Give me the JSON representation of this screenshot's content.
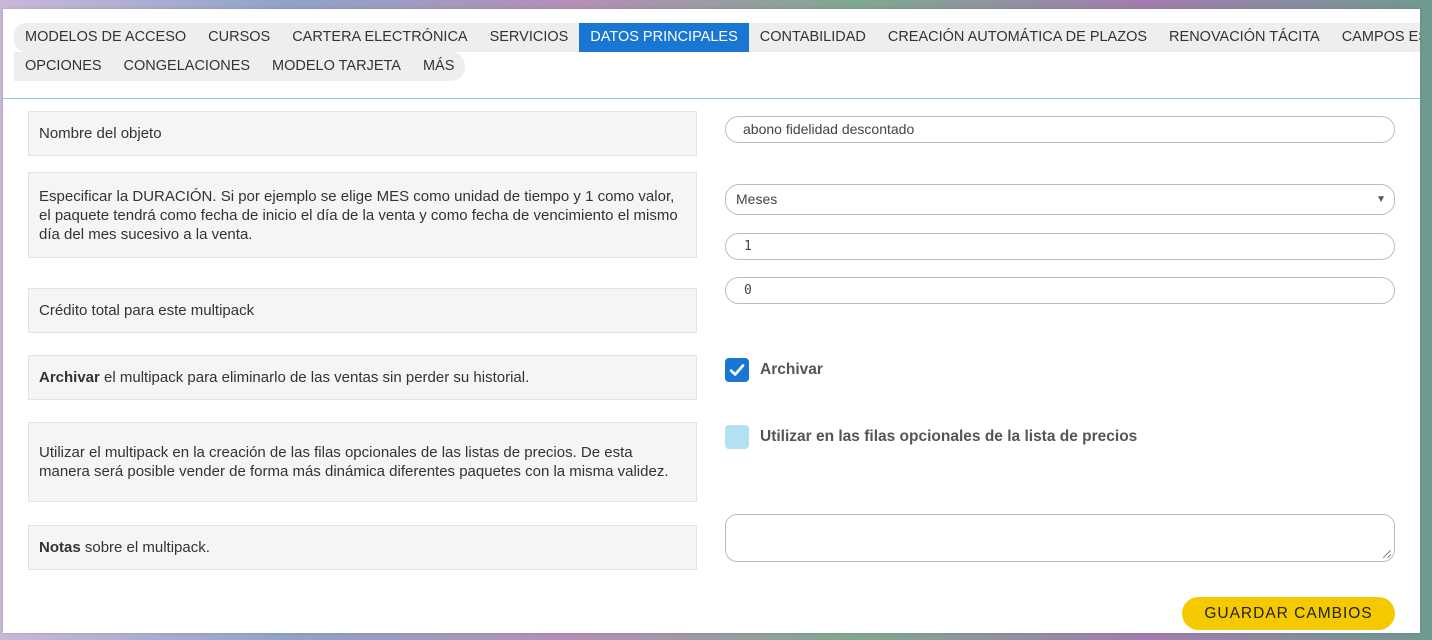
{
  "tabs": {
    "row1": [
      {
        "label": "MODELOS DE ACCESO"
      },
      {
        "label": "CURSOS"
      },
      {
        "label": "CARTERA ELECTRÓNICA"
      },
      {
        "label": "SERVICIOS"
      },
      {
        "label": "DATOS PRINCIPALES",
        "active": true
      },
      {
        "label": "CONTABILIDAD"
      },
      {
        "label": "CREACIÓN AUTOMÁTICA DE PLAZOS"
      },
      {
        "label": "RENOVACIÓN TÁCITA"
      },
      {
        "label": "CAMPOS ESTADÍSTICOS"
      }
    ],
    "row2": [
      {
        "label": "OPCIONES"
      },
      {
        "label": "CONGELACIONES"
      },
      {
        "label": "MODELO TARJETA"
      },
      {
        "label": "MÁS"
      }
    ]
  },
  "form": {
    "name": {
      "label": "Nombre del objeto",
      "value": "abono fidelidad descontado"
    },
    "duration": {
      "label": "Especificar la DURACIÓN. Si por ejemplo se elige MES como unidad de tiempo y 1 como valor, el paquete tendrá como fecha de inicio el día de la venta y como fecha de vencimiento el mismo día del mes sucesivo a la venta.",
      "unit": "Meses",
      "value": "1"
    },
    "credit": {
      "label": "Crédito total para este multipack",
      "value": "0"
    },
    "archive": {
      "label_bold": "Archivar",
      "label_rest": " el multipack para eliminarlo de las ventas sin perder su historial.",
      "checkbox_label": "Archivar",
      "checked": true
    },
    "optional_rows": {
      "label": "Utilizar el multipack en la creación de las filas opcionales de las listas de precios. De esta manera será posible vender de forma más dinámica diferentes paquetes con la misma validez.",
      "checkbox_label": "Utilizar en las filas opcionales de la lista de precios",
      "checked": false
    },
    "notes": {
      "label_bold": "Notas",
      "label_rest": " sobre el multipack.",
      "value": ""
    }
  },
  "actions": {
    "save_label": "GUARDAR CAMBIOS"
  },
  "colors": {
    "accent": "#1976d2",
    "save": "#f5c900",
    "unchecked": "#b3e1f3"
  }
}
